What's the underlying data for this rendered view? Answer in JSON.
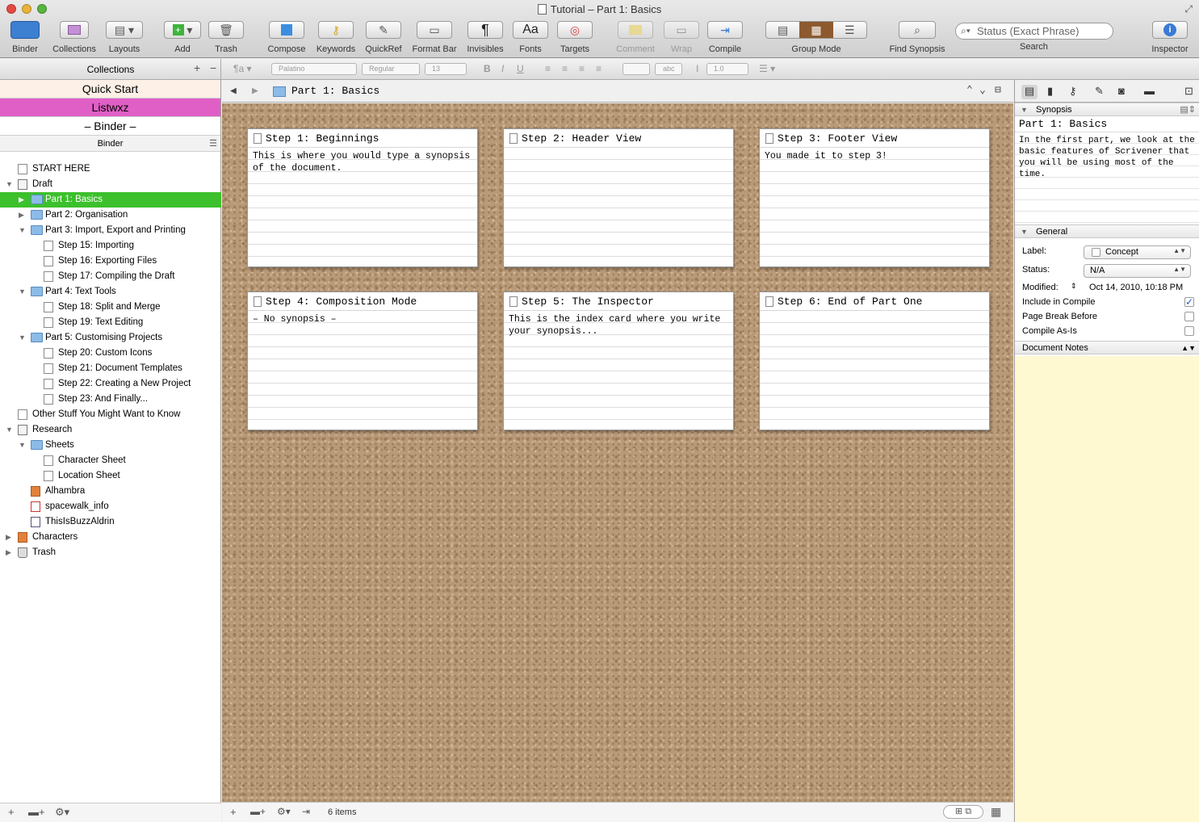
{
  "window": {
    "title": "Tutorial – Part 1: Basics"
  },
  "toolbar": {
    "binder": "Binder",
    "collections": "Collections",
    "layouts": "Layouts",
    "add": "Add",
    "trash": "Trash",
    "compose": "Compose",
    "keywords": "Keywords",
    "quickref": "QuickRef",
    "format_bar": "Format Bar",
    "invisibles": "Invisibles",
    "fonts": "Fonts",
    "targets": "Targets",
    "comment": "Comment",
    "wrap": "Wrap",
    "compile": "Compile",
    "group_mode": "Group Mode",
    "find_synopsis": "Find Synopsis",
    "search_placeholder": "Status (Exact Phrase)",
    "search": "Search",
    "inspector": "Inspector",
    "fonts_glyph": "Aa",
    "invisibles_glyph": "¶"
  },
  "format_bar": {
    "font": "Palatino",
    "style": "Regular",
    "size": "13",
    "spacing": "1.0",
    "highlight": "abc"
  },
  "binder": {
    "collections_header": "Collections",
    "collection_tabs": [
      "Quick Start",
      "Listwxz",
      "– Binder –"
    ],
    "binder_label": "Binder",
    "items": [
      {
        "label": "START HERE",
        "icon": "doc"
      },
      {
        "label": "Draft",
        "icon": "draft"
      },
      {
        "label": "Part 1: Basics",
        "icon": "folder"
      },
      {
        "label": "Part 2: Organisation",
        "icon": "folder"
      },
      {
        "label": "Part 3: Import, Export and Printing",
        "icon": "folder"
      },
      {
        "label": "Step 15: Importing",
        "icon": "doc"
      },
      {
        "label": "Step 16: Exporting Files",
        "icon": "doc"
      },
      {
        "label": "Step 17: Compiling the Draft",
        "icon": "doc"
      },
      {
        "label": "Part 4: Text Tools",
        "icon": "folder"
      },
      {
        "label": "Step 18: Split and Merge",
        "icon": "doc"
      },
      {
        "label": "Step 19: Text Editing",
        "icon": "doc"
      },
      {
        "label": "Part 5: Customising Projects",
        "icon": "folder"
      },
      {
        "label": "Step 20: Custom Icons",
        "icon": "doc"
      },
      {
        "label": "Step 21: Document Templates",
        "icon": "doc"
      },
      {
        "label": "Step 22: Creating a New Project",
        "icon": "doc"
      },
      {
        "label": "Step 23: And Finally...",
        "icon": "doc"
      },
      {
        "label": "Other Stuff You Might Want to Know",
        "icon": "doc"
      },
      {
        "label": "Research",
        "icon": "draft"
      },
      {
        "label": "Sheets",
        "icon": "folder"
      },
      {
        "label": "Character Sheet",
        "icon": "doc"
      },
      {
        "label": "Location Sheet",
        "icon": "doc"
      },
      {
        "label": "Alhambra",
        "icon": "img"
      },
      {
        "label": "spacewalk_info",
        "icon": "pdf"
      },
      {
        "label": "ThisIsBuzzAldrin",
        "icon": "audio"
      },
      {
        "label": "Characters",
        "icon": "img"
      },
      {
        "label": "Trash",
        "icon": "trash"
      }
    ]
  },
  "editor": {
    "path": "Part 1: Basics",
    "cards": [
      {
        "title": "Step 1: Beginnings",
        "synopsis": "This is where you would type a synopsis of the document."
      },
      {
        "title": "Step 2: Header View",
        "synopsis": ""
      },
      {
        "title": "Step 3: Footer View",
        "synopsis": "You made it to step 3!"
      },
      {
        "title": "Step 4: Composition Mode",
        "synopsis": "– No synopsis –"
      },
      {
        "title": "Step 5: The Inspector",
        "synopsis": "This is the index card where you write your synopsis..."
      },
      {
        "title": "Step 6: End of Part One",
        "synopsis": ""
      }
    ],
    "item_count": "6 items"
  },
  "inspector": {
    "synopsis_header": "Synopsis",
    "doc_title": "Part 1: Basics",
    "synopsis_text": "In the first part, we look at the basic features of Scrivener that you will be using most of the time.",
    "general_header": "General",
    "label_caption": "Label:",
    "label_value": "Concept",
    "status_caption": "Status:",
    "status_value": "N/A",
    "modified_caption": "Modified:",
    "modified_value": "Oct 14, 2010, 10:18 PM",
    "include_in_compile": "Include in Compile",
    "include_checked": true,
    "page_break_before": "Page Break Before",
    "page_break_checked": false,
    "compile_as_is": "Compile As-Is",
    "compile_as_is_checked": false,
    "document_notes": "Document Notes"
  },
  "colors": {
    "selection": "#3cc02c",
    "listwxz": "#e05fc6",
    "notes_bg": "#fef9d1",
    "quickstart": "#fdf0e6"
  }
}
